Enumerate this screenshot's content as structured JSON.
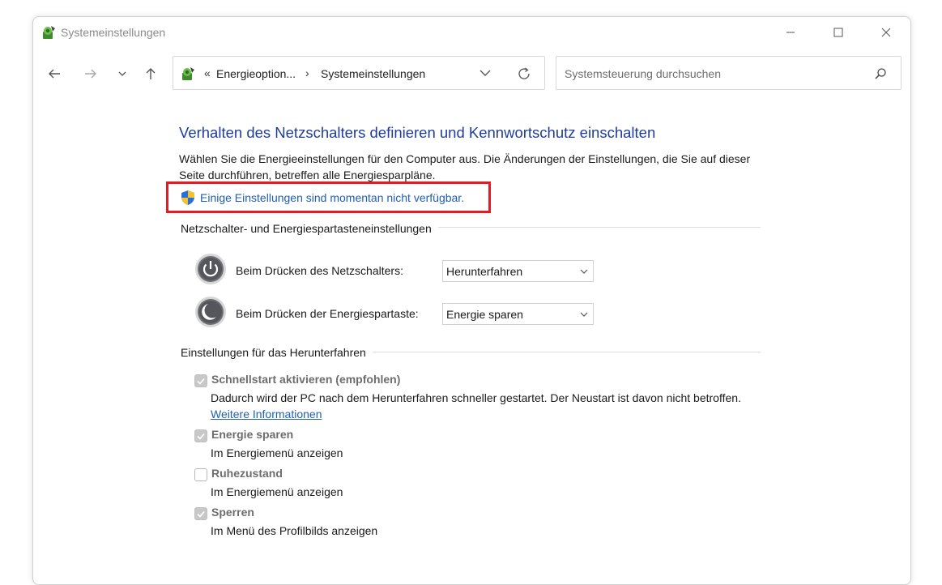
{
  "window": {
    "title": "Systemeinstellungen"
  },
  "address": {
    "segments": [
      "Energieoption...",
      "Systemeinstellungen"
    ],
    "overflow_chevron": "«",
    "separator": "›"
  },
  "search": {
    "placeholder": "Systemsteuerung durchsuchen",
    "value": ""
  },
  "page": {
    "heading": "Verhalten des Netzschalters definieren und Kennwortschutz einschalten",
    "description": "Wählen Sie die Energieeinstellungen für den Computer aus. Die Änderungen der Einstellungen, die Sie auf dieser Seite durchführen, betreffen alle Energiesparpläne.",
    "unavailable_link": "Einige Einstellungen sind momentan nicht verfügbar."
  },
  "power_buttons": {
    "group_title": "Netzschalter- und Energiespartasteneinstellungen",
    "power_label": "Beim Drücken des Netzschalters:",
    "power_value": "Herunterfahren",
    "sleep_label": "Beim Drücken der Energiespartaste:",
    "sleep_value": "Energie sparen"
  },
  "shutdown": {
    "group_title": "Einstellungen für das Herunterfahren",
    "options": [
      {
        "title": "Schnellstart aktivieren (empfohlen)",
        "desc": "Dadurch wird der PC nach dem Herunterfahren schneller gestartet. Der Neustart ist davon nicht betroffen.",
        "link": "Weitere Informationen",
        "checked": true
      },
      {
        "title": "Energie sparen",
        "desc": "Im Energiemenü anzeigen",
        "checked": true
      },
      {
        "title": "Ruhezustand",
        "desc": "Im Energiemenü anzeigen",
        "checked": false
      },
      {
        "title": "Sperren",
        "desc": "Im Menü des Profilbilds anzeigen",
        "checked": true
      }
    ]
  },
  "colors": {
    "heading": "#1f3d99",
    "link": "#1f5fb5",
    "highlight": "#e31b23"
  }
}
